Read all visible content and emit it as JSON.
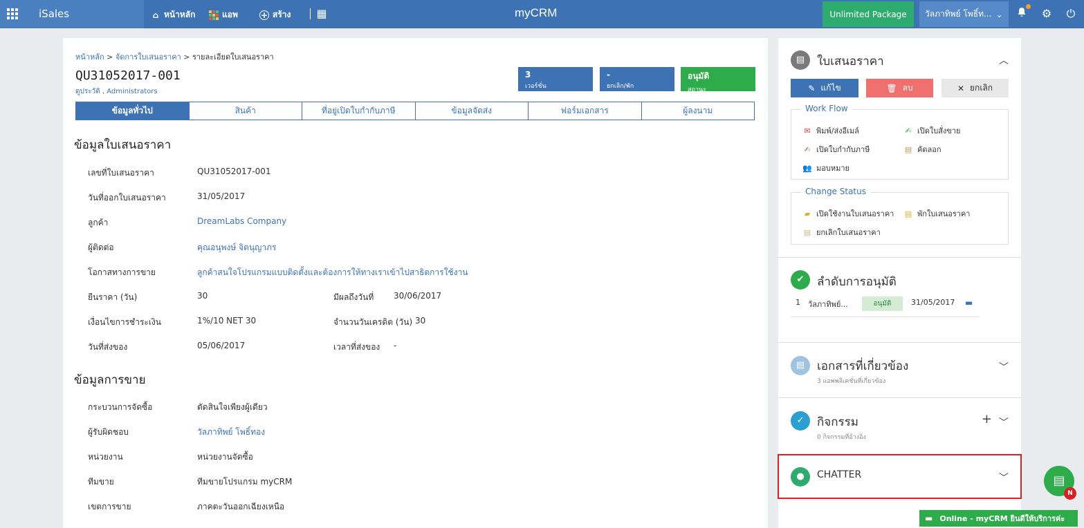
{
  "topbar": {
    "brand": "iSales",
    "nav": [
      {
        "label": "หน้าหลัก",
        "icon": "home-icon"
      },
      {
        "label": "แอพ",
        "icon": "apps-color-icon"
      },
      {
        "label": "สร้าง",
        "icon": "plus-circle-icon"
      }
    ],
    "logo": "myCRM",
    "package_label": "Unlimited Package",
    "user_name": "วัลภาทิพย์ โพธิ์ท...",
    "colors": {
      "bar": "#3d73b4",
      "package": "#2eab6e"
    }
  },
  "breadcrumb": {
    "home": "หน้าหลัก",
    "sep1": ">",
    "manage": "จัดการใบเสนอราคา",
    "sep2": ">",
    "current": "รายละเอียดใบเสนอราคา"
  },
  "document": {
    "title": "QU31052017-001",
    "subtitle": "ดูประวัติ , Administrators"
  },
  "stats": [
    {
      "value": "3",
      "label": "เวอร์ชั่น",
      "color": "#3d73b4"
    },
    {
      "value": "-",
      "label": "ยกเลิก/พัก",
      "color": "#3d73b4"
    },
    {
      "value": "อนุมัติ",
      "label": "สถานะ",
      "color": "#2eab4a"
    }
  ],
  "tabs": [
    "ข้อมูลทั่วไป",
    "สินค้า",
    "ที่อยู่เปิดใบกำกับภาษี",
    "ข้อมูลจัดส่ง",
    "ฟอร์มเอกสาร",
    "ผู้ลงนาม"
  ],
  "quote_info": {
    "heading": "ข้อมูลใบเสนอราคา",
    "rows": {
      "quote_no": {
        "label": "เลขที่ใบเสนอราคา",
        "value": "QU31052017-001"
      },
      "issue_date": {
        "label": "วันที่ออกใบเสนอราคา",
        "value": "31/05/2017"
      },
      "customer": {
        "label": "ลูกค้า",
        "value": "DreamLabs Company"
      },
      "contact": {
        "label": "ผู้ติดต่อ",
        "value": "คุณอนุพงษ์ จิตนุญาภร"
      },
      "opportunity": {
        "label": "โอกาสทางการขาย",
        "value": "ลูกค้าสนใจโปรแกรมแบบติดตั้งและต้องการให้ทางเราเข้าไปสาธิตการใช้งาน"
      },
      "validity": {
        "label": "ยืนราคา (วัน)",
        "value": "30"
      },
      "effective": {
        "label": "มีผลถึงวันที่",
        "value": "30/06/2017"
      },
      "payment": {
        "label": "เงื่อนไขการชำระเงิน",
        "value": "1%/10 NET 30"
      },
      "credit_days": {
        "label": "จำนวนวันเครดิต (วัน)",
        "value": "30"
      },
      "delivery_date": {
        "label": "วันที่ส่งของ",
        "value": "05/06/2017"
      },
      "delivery_time": {
        "label": "เวลาที่ส่งของ",
        "value": "-"
      }
    }
  },
  "sales_info": {
    "heading": "ข้อมูลการขาย",
    "rows": {
      "process": {
        "label": "กระบวนการจัดซื้อ",
        "value": "ตัดสินใจเพียงผู้เดียว"
      },
      "owner": {
        "label": "ผู้รับผิดชอบ",
        "value": "วัลภาทิพย์ โพธิ์ทอง"
      },
      "unit": {
        "label": "หน่วยงาน",
        "value": "หน่วยงานจัดซื้อ"
      },
      "team": {
        "label": "ทีมขาย",
        "value": "ทีมขายโปรแกรม myCRM"
      },
      "territory": {
        "label": "เขตการขาย",
        "value": "ภาคตะวันออกเฉียงเหนือ"
      }
    }
  },
  "side": {
    "quote_title": "ใบเสนอราคา",
    "buttons": {
      "edit": "แก้ไข",
      "delete": "ลบ",
      "cancel": "ยกเลิก"
    },
    "workflow": {
      "label": "Work Flow",
      "items": {
        "print_email": "พิมพ์/ส่งอีเมล์",
        "open_order": "เปิดใบสั่งขาย",
        "open_invoice": "เปิดใบกำกับภาษี",
        "copy": "คัดลอก",
        "assign": "มอบหมาย"
      }
    },
    "change_status": {
      "label": "Change Status",
      "items": {
        "activate": "เปิดใช้งานใบเสนอราคา",
        "hold": "พักใบเสนอราคา",
        "cancel": "ยกเลิกใบเสนอราคา"
      }
    },
    "approval": {
      "title": "ลำดับการอนุมัติ",
      "row": {
        "no": "1",
        "name": "วัลภาทิพย์...",
        "status": "อนุมัติ",
        "date": "31/05/2017"
      }
    },
    "related": {
      "title": "เอกสารที่เกี่ยวข้อง",
      "sub": "3 แอพพลิเคชั่นที่เกี่ยวข้อง"
    },
    "activity": {
      "title": "กิจกรรม",
      "sub": "0 กิจกรรมที่อ้างอิง"
    },
    "chatter": {
      "title": "CHATTER"
    }
  },
  "float": {
    "badge": "N"
  },
  "online": {
    "text": "Online - myCRM ยินดีให้บริการค่ะ"
  }
}
